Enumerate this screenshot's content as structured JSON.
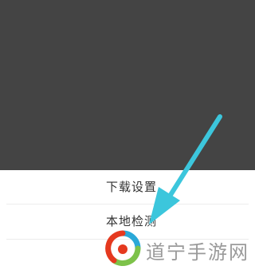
{
  "menu": {
    "items": [
      {
        "label": "下载设置"
      },
      {
        "label": "本地检测"
      }
    ]
  },
  "annotation": {
    "arrow_color": "#3cc6dc"
  },
  "watermark": {
    "text": "道宁手游网",
    "logo_icon": "swirl-logo-icon",
    "colors": [
      "#e5391f",
      "#7dc24a",
      "#2aa8d8"
    ]
  },
  "colors": {
    "overlay": "#444444",
    "sheet": "#ffffff"
  }
}
